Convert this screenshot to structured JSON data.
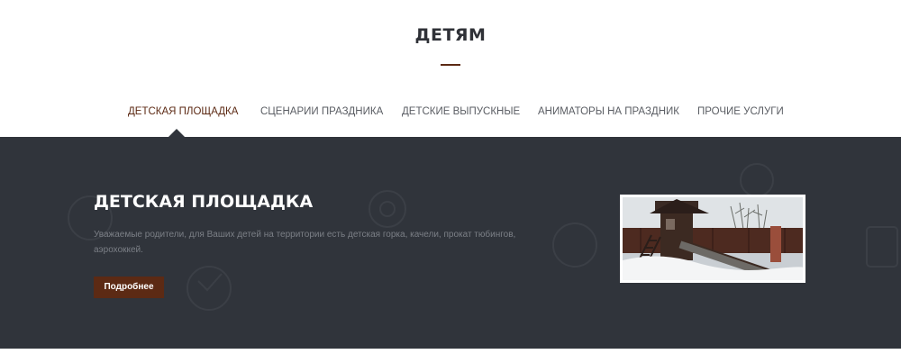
{
  "section": {
    "title": "ДЕТЯМ"
  },
  "tabs": [
    {
      "label": "ДЕТСКАЯ ПЛОЩАДКА",
      "active": true
    },
    {
      "label": "СЦЕНАРИИ ПРАЗДНИКА",
      "active": false
    },
    {
      "label": "ДЕТСКИЕ ВЫПУСКНЫЕ",
      "active": false
    },
    {
      "label": "АНИМАТОРЫ НА ПРАЗДНИК",
      "active": false
    },
    {
      "label": "ПРОЧИЕ УСЛУГИ",
      "active": false
    }
  ],
  "panel": {
    "title": "ДЕТСКАЯ ПЛОЩАДКА",
    "text": "Уважаемые родители, для Ваших детей на территории есть детская горка, качели, прокат тюбингов, аэрохоккей.",
    "button_label": "Подробнее"
  },
  "colors": {
    "accent": "#5c2a14",
    "panel_bg": "#30343b",
    "heading": "#2f3137",
    "tab_text": "#5a5d63",
    "panel_text": "#7b7f86"
  },
  "icons": {
    "background": "outline-circle-icons-decoration",
    "photo": "wooden-playground-slide-in-snow"
  }
}
